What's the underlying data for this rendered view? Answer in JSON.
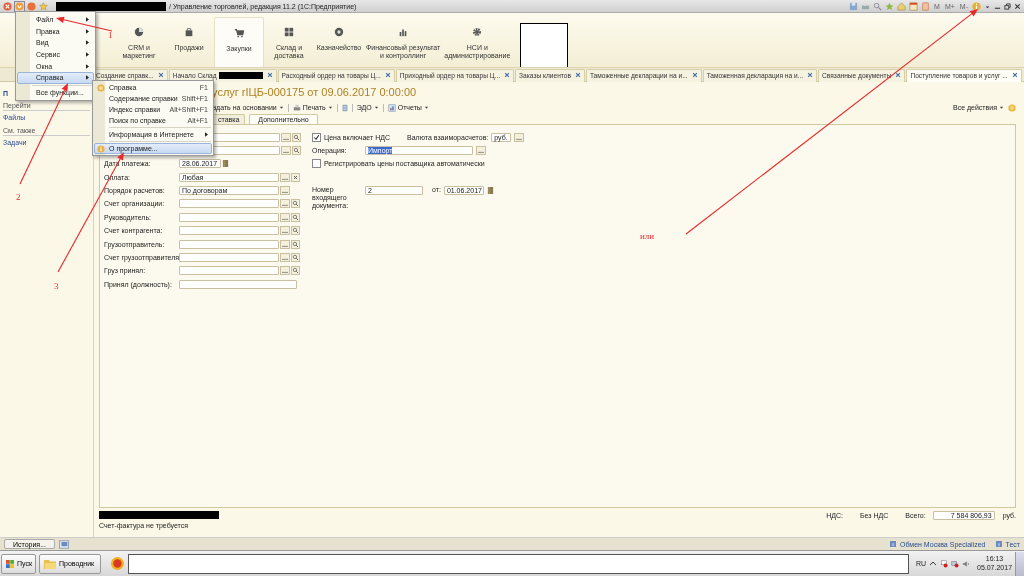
{
  "title_bar": {
    "title": "/ Управление торговлей, редакция 11.2 (1С:Предприятие)",
    "memory_buttons": [
      "M",
      "M+",
      "M-"
    ]
  },
  "sections": [
    {
      "label": "CRM и\nмаркетинг",
      "kind": "pie",
      "selected": false
    },
    {
      "label": "Продажи",
      "kind": "bag",
      "selected": false
    },
    {
      "label": "Закупки",
      "kind": "cart",
      "selected": true
    },
    {
      "label": "Склад и\nдоставка",
      "kind": "grid",
      "selected": false
    },
    {
      "label": "Казначейство",
      "kind": "coin",
      "selected": false
    },
    {
      "label": "Финансовый результат\nи контроллинг",
      "kind": "bars",
      "selected": false
    },
    {
      "label": "НСИ и\nадминистрирование",
      "kind": "gear",
      "selected": false
    }
  ],
  "tabs": [
    {
      "label": "Создание справк...",
      "selected": false,
      "redacted": false
    },
    {
      "label": "Начало Склад",
      "selected": false,
      "redacted": true
    },
    {
      "label": "Расходный ордер на товары Ц...",
      "selected": false,
      "redacted": false
    },
    {
      "label": "Приходный ордер на товары Ц...",
      "selected": false,
      "redacted": false
    },
    {
      "label": "Заказы клиентов",
      "selected": false,
      "redacted": false
    },
    {
      "label": "Таможенные декларации на и...",
      "selected": false,
      "redacted": false
    },
    {
      "label": "Таможенная декларация на и...",
      "selected": false,
      "redacted": false
    },
    {
      "label": "Связанные документы",
      "selected": false,
      "redacted": false
    },
    {
      "label": "Поступление товаров и услуг ...",
      "selected": true,
      "redacted": false
    }
  ],
  "sidebar": {
    "header": "П",
    "groups": [
      {
        "title": "Перейти",
        "links": [
          "Файлы"
        ]
      },
      {
        "title": "См. также",
        "links": [
          "Задачи"
        ]
      }
    ]
  },
  "form": {
    "title": "услуг rIЦБ-000175 от 09.06.2017 0:00:00",
    "toolbar": [
      {
        "kind": "menu",
        "label": "здать на основании"
      },
      {
        "kind": "print",
        "label": "Печать"
      },
      {
        "kind": "list"
      },
      {
        "kind": "menu",
        "label": "ЭДО"
      },
      {
        "kind": "reports",
        "label": "Отчеты"
      }
    ],
    "all_actions": "Все действия",
    "tabs": [
      {
        "label": "ставка",
        "selected": false
      },
      {
        "label": "Дополнительно",
        "selected": true
      }
    ],
    "left_fields": [
      {
        "kind": "select"
      },
      {
        "kind": "select"
      },
      {
        "label": "Дата платежа:",
        "kind": "date",
        "value": "28.06.2017"
      },
      {
        "label": "Оплата:",
        "kind": "clear",
        "value": "Любая"
      },
      {
        "label": "Порядок расчетов:",
        "kind": "choice",
        "value": "По договорам"
      },
      {
        "label": "Счет организации:",
        "kind": "select"
      },
      {
        "label": "Руководитель:",
        "kind": "select"
      },
      {
        "label": "Счет контрагента:",
        "kind": "select"
      },
      {
        "label": "Грузоотправитель:",
        "kind": "select"
      },
      {
        "label": "Счет грузоотправителя:",
        "kind": "select"
      },
      {
        "label": "Груз принял:",
        "kind": "select"
      },
      {
        "label": "Принял (должность):",
        "kind": "plain"
      }
    ],
    "price_includes_vat": {
      "label": "Цена включает НДС",
      "checked": true
    },
    "currency": {
      "label": "Валюта взаиморасчетов:",
      "value": "руб."
    },
    "operation": {
      "label": "Операция:",
      "value": "Импорт"
    },
    "register_prices": {
      "label": "Регистрировать цены поставщика автоматически",
      "checked": false
    },
    "incoming_number": {
      "label": "Номер входящего документа:",
      "value": "2"
    },
    "incoming_date": {
      "label": "от:",
      "value": "01.06.2017"
    },
    "footer": {
      "vat_label": "НДС:",
      "no_vat": "Без НДС",
      "total_label": "Всего:",
      "total": "7 584 806,93",
      "currency": "руб.",
      "invoice_note": "Счет-фактура не требуется"
    }
  },
  "bottom_bar": {
    "history_button": "История...",
    "links": [
      "Обмен Москва Specialized",
      "Тест"
    ]
  },
  "main_menu": [
    {
      "label": "Файл",
      "submenu": true,
      "selected": false
    },
    {
      "label": "Правка",
      "submenu": true,
      "selected": false
    },
    {
      "label": "Вид",
      "submenu": true,
      "selected": false
    },
    {
      "label": "Сервис",
      "submenu": true,
      "selected": false
    },
    {
      "label": "Окна",
      "submenu": true,
      "selected": false
    },
    {
      "label": "Справка",
      "submenu": true,
      "selected": true
    },
    {
      "label": "Все функции...",
      "submenu": false,
      "selected": false
    }
  ],
  "help_menu": [
    {
      "kind": "help",
      "label": "Справка",
      "shortcut": "F1",
      "selected": false
    },
    {
      "kind": "plain",
      "label": "Содержание справки",
      "shortcut": "Shift+F1",
      "selected": false
    },
    {
      "kind": "plain",
      "label": "Индекс справки",
      "shortcut": "Alt+Shift+F1",
      "selected": false
    },
    {
      "kind": "plain",
      "label": "Поиск по справке",
      "shortcut": "Alt+F1",
      "selected": false
    },
    {
      "kind": "submenu",
      "label": "Информация в Интернете",
      "selected": false
    },
    {
      "kind": "info",
      "label": "О программе...",
      "selected": true
    }
  ],
  "annotations": [
    {
      "label": "1"
    },
    {
      "label": "2"
    },
    {
      "label": "3"
    },
    {
      "label": "или"
    }
  ],
  "taskbar": {
    "start": "Пуск",
    "apps": [
      "Проводник"
    ],
    "language": "RU",
    "time": "16:13",
    "date": "05.07.2017"
  }
}
